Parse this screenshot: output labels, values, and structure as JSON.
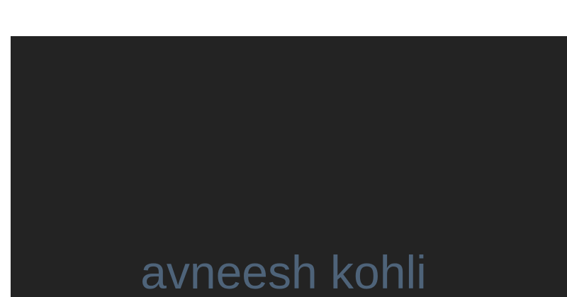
{
  "hero": {
    "name": "avneesh kohli"
  },
  "colors": {
    "page_background": "#ffffff",
    "panel_background": "#232323",
    "name_text": "#4e6379"
  }
}
